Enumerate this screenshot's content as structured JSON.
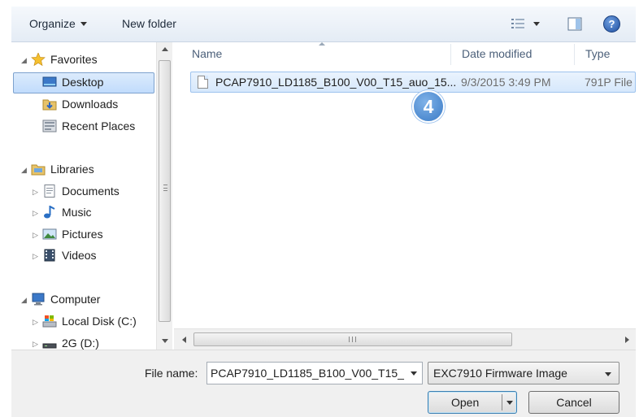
{
  "toolbar": {
    "organize_label": "Organize",
    "new_folder_label": "New folder",
    "view_icon": "details-view-icon",
    "preview_icon": "preview-pane-icon",
    "help_glyph": "?"
  },
  "nav": {
    "favorites": "Favorites",
    "desktop": "Desktop",
    "downloads": "Downloads",
    "recent_places": "Recent Places",
    "libraries": "Libraries",
    "documents": "Documents",
    "music": "Music",
    "pictures": "Pictures",
    "videos": "Videos",
    "computer": "Computer",
    "local_disk": "Local Disk (C:)",
    "drive_d": "2G (D:)"
  },
  "columns": {
    "name": "Name",
    "date_modified": "Date modified",
    "type": "Type"
  },
  "files": [
    {
      "name": "PCAP7910_LD1185_B100_V00_T15_auo_15...",
      "date": "9/3/2015 3:49 PM",
      "type": "791P File"
    }
  ],
  "step_badge": "4",
  "bottom": {
    "file_name_label": "File name:",
    "file_name_value": "PCAP7910_LD1185_B100_V00_T15_",
    "filter_value": "EXC7910 Firmware Image",
    "open_label": "Open",
    "cancel_label": "Cancel"
  },
  "colors": {
    "selection_fill": "#c1dcfc",
    "selection_border": "#7da2ce",
    "badge": "#3b7bc6"
  }
}
